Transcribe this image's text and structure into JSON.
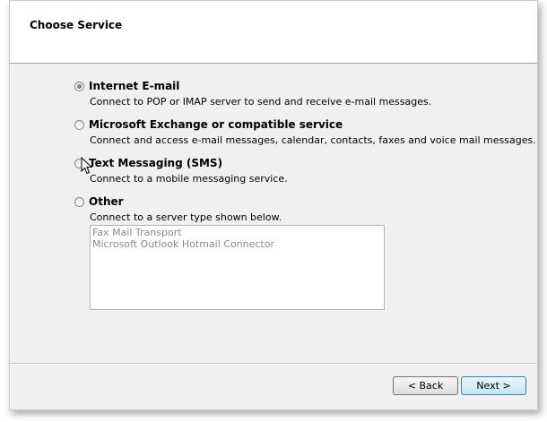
{
  "header": {
    "title": "Choose Service"
  },
  "options": [
    {
      "label": "Internet E-mail",
      "description": "Connect to POP or IMAP server to send and receive e-mail messages.",
      "checked": true
    },
    {
      "label": "Microsoft Exchange or compatible service",
      "description": "Connect and access e-mail messages, calendar, contacts, faxes and voice mail messages.",
      "checked": false
    },
    {
      "label": "Text Messaging (SMS)",
      "description": "Connect to a mobile messaging service.",
      "checked": false
    },
    {
      "label": "Other",
      "description": "Connect to a server type shown below.",
      "checked": false
    }
  ],
  "other_list": {
    "items": [
      "Fax Mail Transport",
      "Microsoft Outlook Hotmail Connector"
    ]
  },
  "footer": {
    "back_label": "< Back",
    "next_label": "Next >"
  }
}
